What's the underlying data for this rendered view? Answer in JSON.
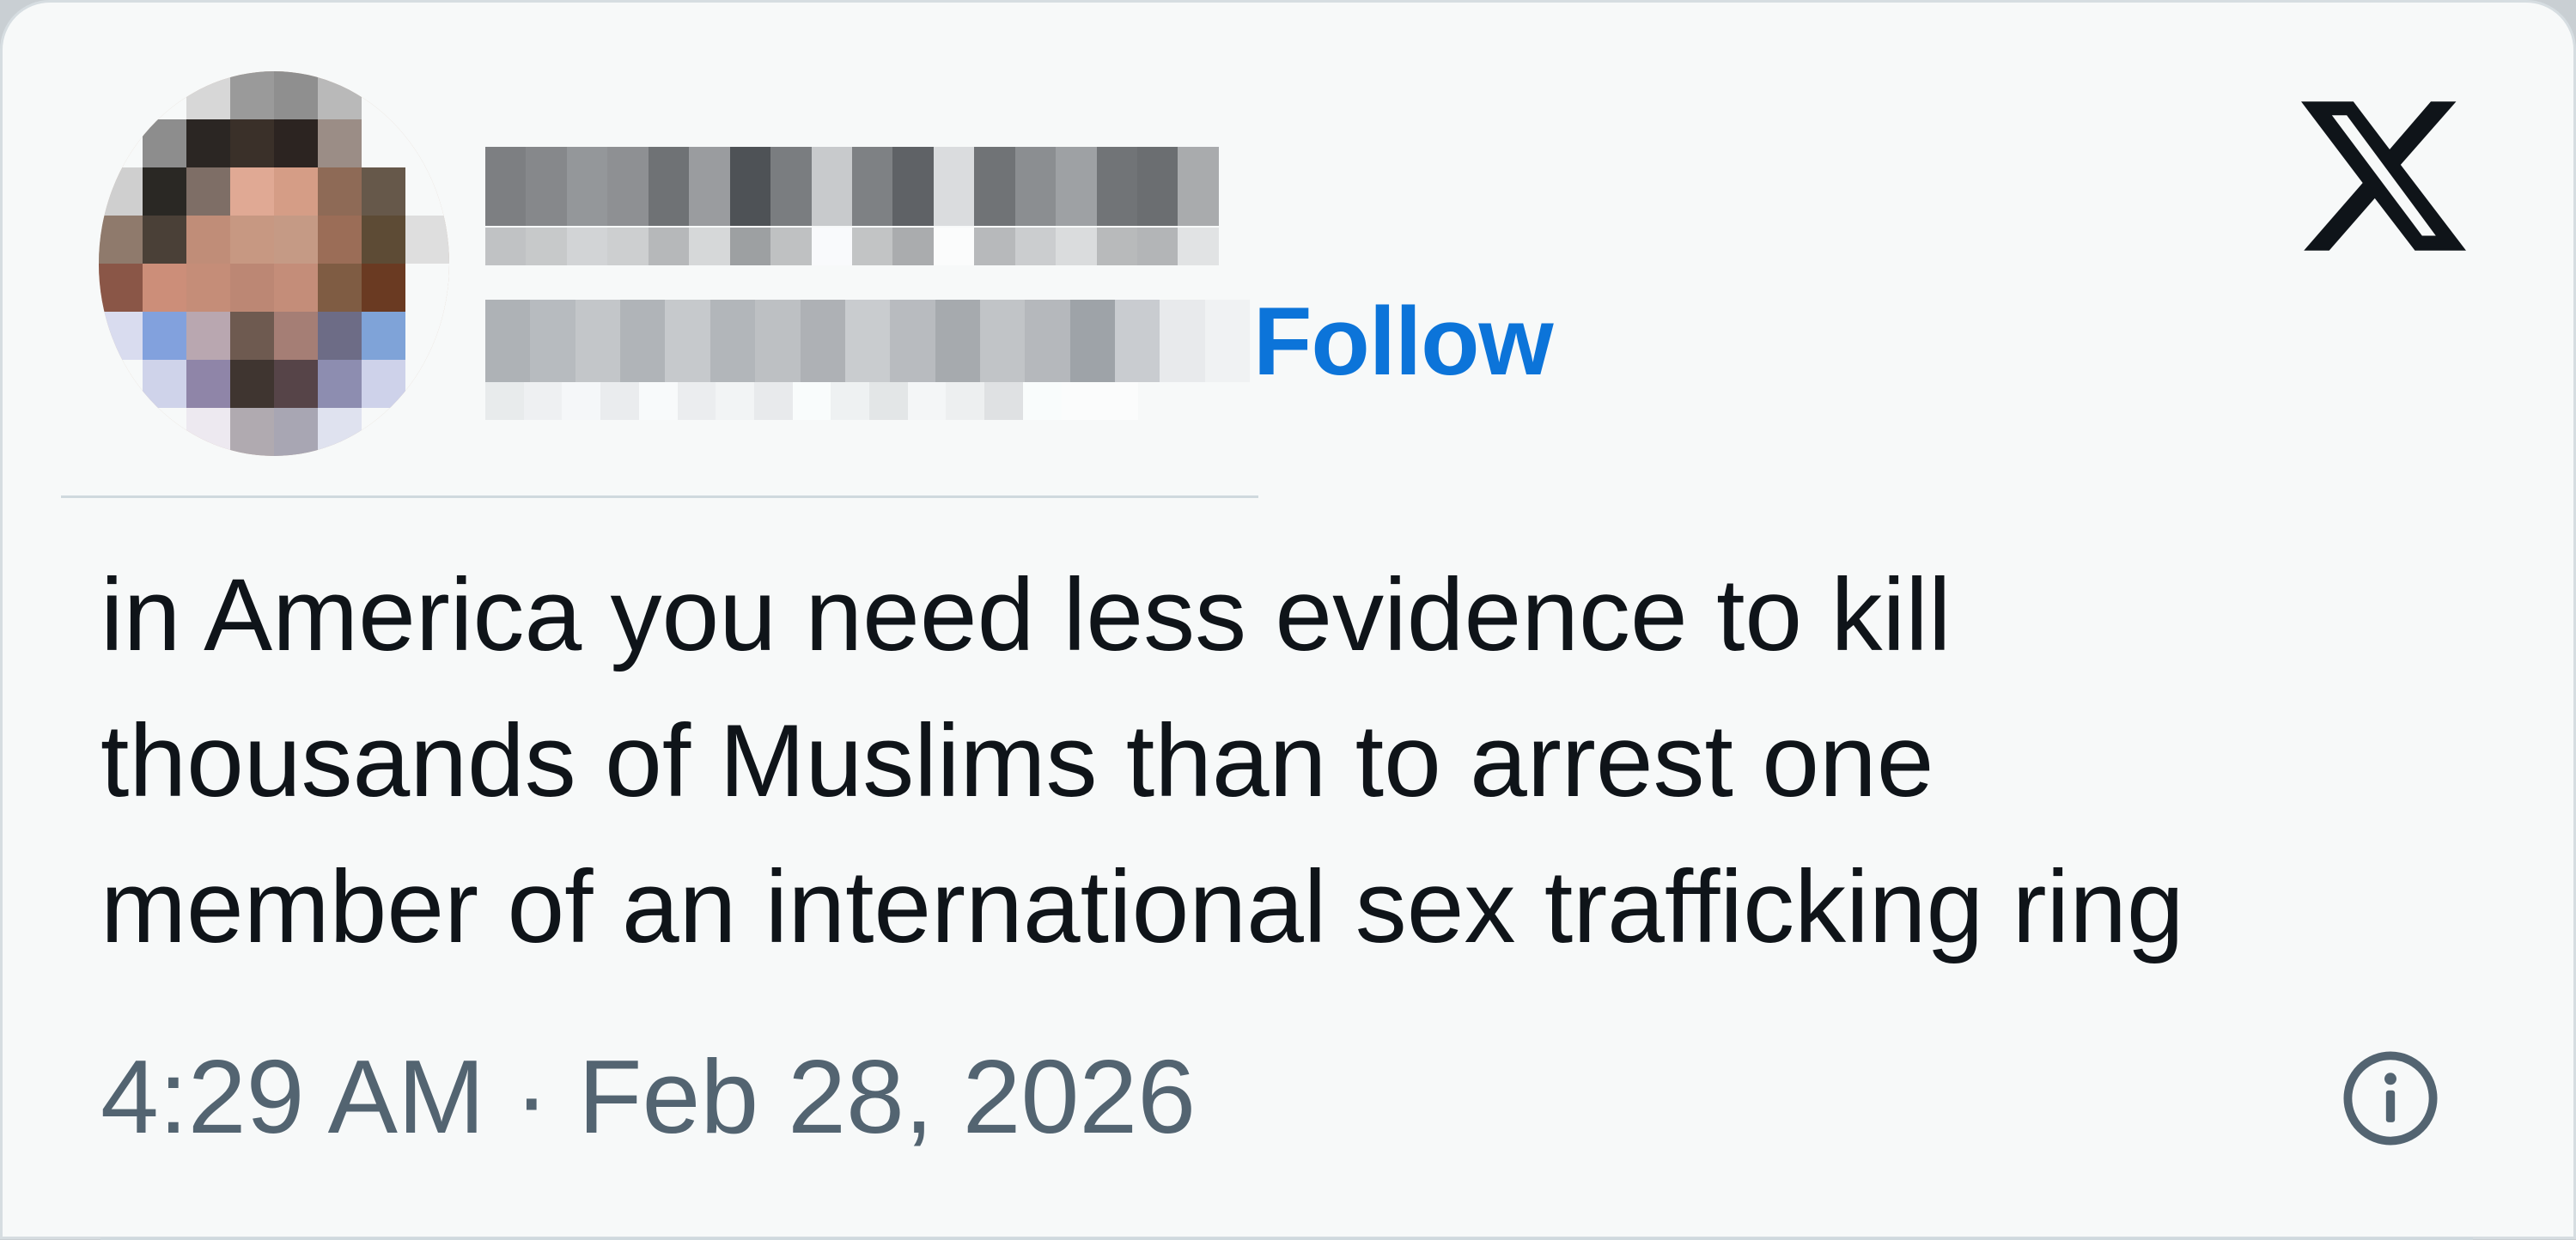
{
  "author": {
    "follow_label": "Follow",
    "avatar_pixels": [
      "#f7f9f9",
      "#f7f9f9",
      "#d7d7d7",
      "#9a9a9a",
      "#8f8f8f",
      "#b9b9b9",
      "#f7f9f9",
      "#f7f9f9",
      "#f7f9f9",
      "#8d8d8d",
      "#2b2623",
      "#3a3029",
      "#2c2421",
      "#9b8d86",
      "#f7f9f9",
      "#f7f9f9",
      "#cfcfcf",
      "#2a2824",
      "#7e6e66",
      "#e0a994",
      "#d59d86",
      "#8e6a56",
      "#66584a",
      "#f7f9f9",
      "#8f7a6c",
      "#4a4037",
      "#c08d78",
      "#c79882",
      "#c59a85",
      "#9b6d57",
      "#5d4b35",
      "#dedede",
      "#8a5647",
      "#cc8e79",
      "#c58d78",
      "#bc8774",
      "#c48d79",
      "#7f5c43",
      "#6a3a22",
      "#f7f9f9",
      "#d9dcef",
      "#82a1dd",
      "#b9a7b0",
      "#6e5a50",
      "#a57e75",
      "#6d6c86",
      "#7fa3d8",
      "#f7f9f9",
      "#f7f9f9",
      "#cfd3ea",
      "#8f85a8",
      "#3f3530",
      "#564448",
      "#8d8db0",
      "#ced2ea",
      "#f7f9f9",
      "#f7f9f9",
      "#f7f9f9",
      "#ede9f0",
      "#b0aab0",
      "#a8a6b3",
      "#dfe2ef",
      "#f7f9f9",
      "#f7f9f9"
    ],
    "name_pixels": [
      "#7d7f82",
      "#86888b",
      "#94979a",
      "#8e9093",
      "#6f7275",
      "#9a9c9f",
      "#4e5256",
      "#7a7d80",
      "#c8cacc",
      "#7e8184",
      "#5f6266",
      "#dadcde",
      "#707376",
      "#8b8e91",
      "#9ea1a4",
      "#717477",
      "#6b6e71",
      "#a9abad"
    ],
    "handle_pixels": [
      "#aeb2b6",
      "#b7bbbf",
      "#c3c6c9",
      "#b0b4b8",
      "#c6c9cc",
      "#b2b6ba",
      "#bdc0c3",
      "#aeb1b5",
      "#c9cccf",
      "#b8bbbf",
      "#a6aaae",
      "#c1c4c7",
      "#b5b8bc",
      "#9ea3a8",
      "#c9ccd0",
      "#e8eaec",
      "#f0f2f3"
    ]
  },
  "brand": {
    "logo_icon": "x-logo-icon"
  },
  "tweet": {
    "lines": [
      "in America you need less evidence to kill",
      "thousands of Muslims than to arrest one",
      "member of an international sex trafficking ring"
    ],
    "timestamp": "4:29 AM · Feb 28, 2026",
    "info_icon": "info-icon"
  },
  "colors": {
    "follow": "#0c74d9",
    "text": "#0f1419",
    "meta": "#536471",
    "background": "#f7f9f9"
  }
}
